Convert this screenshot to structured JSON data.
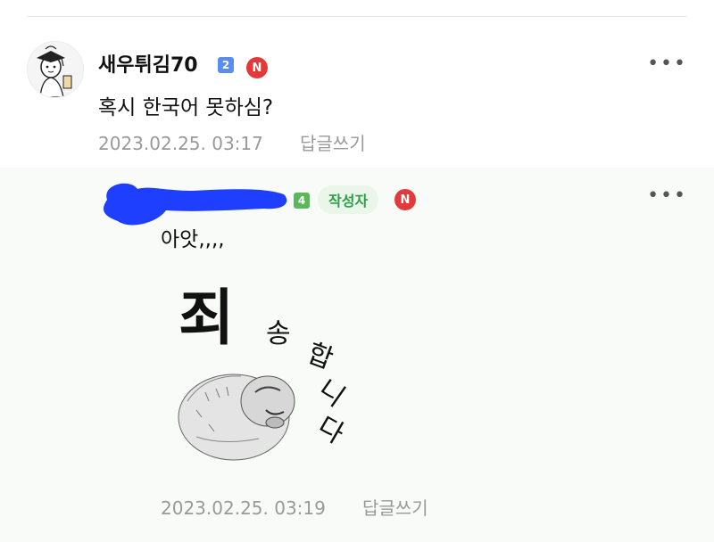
{
  "comment1": {
    "nickname": "새우튀김70",
    "level": "2",
    "new_badge": "N",
    "text": "혹시 한국어 못하심?",
    "date": "2023.02.25. 03:17",
    "reply_label": "답글쓰기",
    "more_label": "•••"
  },
  "comment2": {
    "level": "4",
    "author_badge": "작성자",
    "new_badge": "N",
    "text": "아앗,,,,",
    "date": "2023.02.25. 03:19",
    "reply_label": "답글쓰기",
    "more_label": "•••",
    "sticker": {
      "big_char": "죄",
      "small_chars": [
        "송",
        "합",
        "니",
        "다"
      ]
    }
  },
  "colors": {
    "scribble": "#1f3fff",
    "new_badge": "#e23a3a",
    "author_badge_text": "#2e9e46",
    "meta_text": "#999999"
  }
}
